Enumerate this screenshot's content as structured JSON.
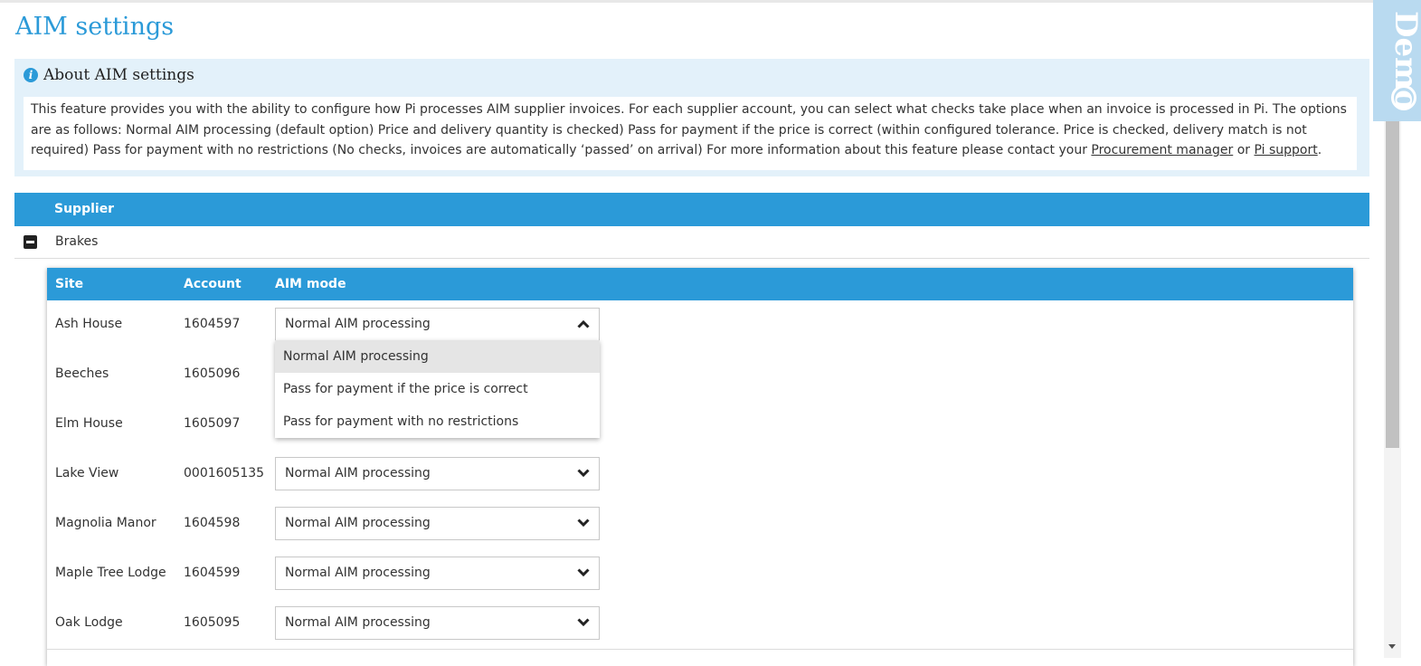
{
  "page": {
    "title": "AIM settings"
  },
  "about": {
    "title": "About AIM settings",
    "text": "This feature provides you with the ability to configure how Pi processes AIM supplier invoices. For each supplier account, you can select what checks take place when an invoice is processed in Pi. The options are as follows: Normal AIM processing (default option) Price and delivery quantity is checked) Pass for payment if the price is correct (within configured tolerance. Price is checked, delivery match is not required) Pass for payment with no restrictions (No checks, invoices are automatically ‘passed’ on arrival) For more information about this feature please contact your",
    "link1": "Procurement manager",
    "conj": "or",
    "link2": "Pi support",
    "end": "."
  },
  "supplier_table": {
    "header": "Supplier",
    "supplier_name": "Brakes"
  },
  "accounts_table": {
    "headers": {
      "site": "Site",
      "account": "Account",
      "aim_mode": "AIM mode"
    },
    "rows": [
      {
        "site": "Ash House",
        "account": "1604597",
        "aim_mode": "Normal AIM processing"
      },
      {
        "site": "Beeches",
        "account": "1605096",
        "aim_mode": ""
      },
      {
        "site": "Elm House",
        "account": "1605097",
        "aim_mode": ""
      },
      {
        "site": "Lake View",
        "account": "0001605135",
        "aim_mode": "Normal AIM processing"
      },
      {
        "site": "Magnolia Manor",
        "account": "1604598",
        "aim_mode": "Normal AIM processing"
      },
      {
        "site": "Maple Tree Lodge",
        "account": "1604599",
        "aim_mode": "Normal AIM processing"
      },
      {
        "site": "Oak Lodge",
        "account": "1605095",
        "aim_mode": "Normal AIM processing"
      }
    ]
  },
  "dropdown": {
    "options": [
      "Normal AIM processing",
      "Pass for payment if the price is correct",
      "Pass for payment with no restrictions"
    ],
    "selected": "Normal AIM processing"
  },
  "side_tab": {
    "label": "Demo"
  },
  "colors": {
    "accent": "#2b9ad8",
    "info_bg": "#e3f1fa"
  }
}
